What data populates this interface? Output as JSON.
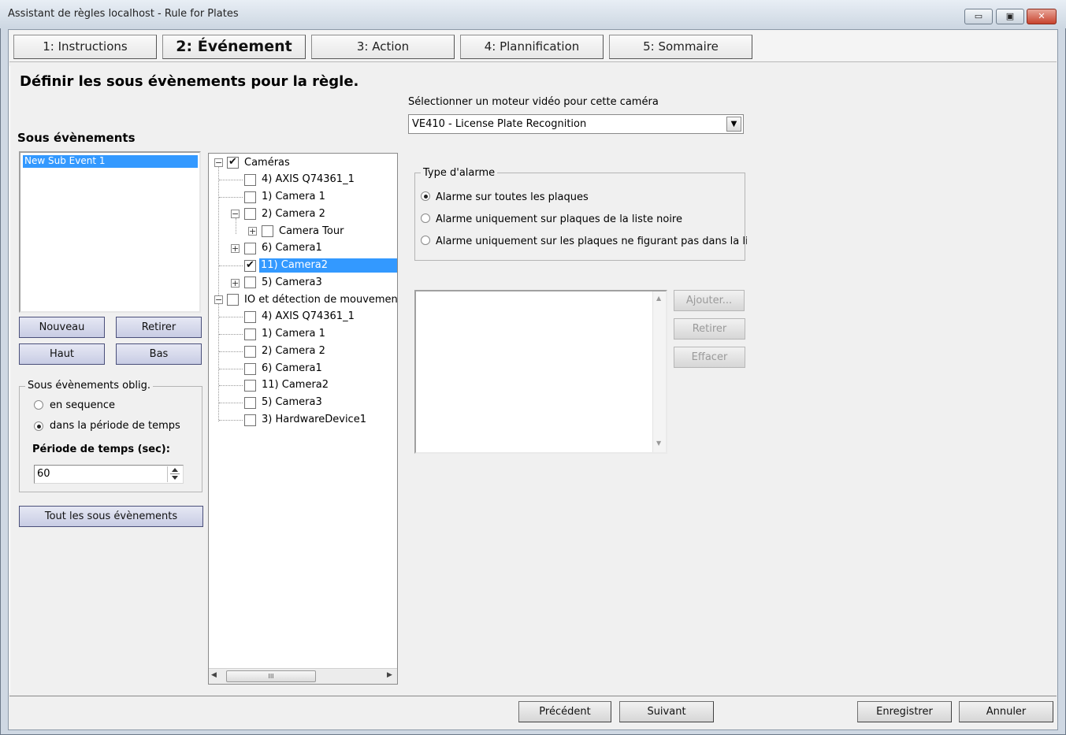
{
  "window": {
    "title": "Assistant de règles localhost - Rule for Plates",
    "minimize": "▭",
    "restore": "▣",
    "close": "✕"
  },
  "tabs": [
    "1: Instructions",
    "2: Événement",
    "3: Action",
    "4: Plannification",
    "5: Sommaire"
  ],
  "active_tab": 1,
  "heading": "Définir les sous évènements pour la règle.",
  "sub_events": {
    "title": "Sous évènements",
    "items": [
      "New Sub Event 1"
    ],
    "selected": 0,
    "buttons": {
      "new": "Nouveau",
      "remove": "Retirer",
      "up": "Haut",
      "down": "Bas",
      "all": "Tout les sous évènements"
    }
  },
  "mandatory": {
    "title": "Sous évènements oblig.",
    "options": [
      "en sequence",
      "dans la période de temps"
    ],
    "selected": 1,
    "period_label": "Période de temps (sec):",
    "period_value": "60"
  },
  "tree": {
    "nodes": [
      {
        "label": "Caméras",
        "checked": true,
        "expander": "−"
      },
      {
        "label": "4) AXIS Q74361_1",
        "checked": false
      },
      {
        "label": "1) Camera 1",
        "checked": false
      },
      {
        "label": "2) Camera 2",
        "checked": false,
        "expander": "−"
      },
      {
        "label": "Camera Tour",
        "checked": false,
        "expander": "+"
      },
      {
        "label": "6) Camera1",
        "checked": false,
        "expander": "+"
      },
      {
        "label": "11) Camera2",
        "checked": true,
        "selected": true
      },
      {
        "label": "5) Camera3",
        "checked": false,
        "expander": "+"
      },
      {
        "label": "IO et détection de mouvement su",
        "checked": false,
        "expander": "−"
      },
      {
        "label": "4) AXIS Q74361_1",
        "checked": false
      },
      {
        "label": "1) Camera 1",
        "checked": false
      },
      {
        "label": "2) Camera 2",
        "checked": false
      },
      {
        "label": "6) Camera1",
        "checked": false
      },
      {
        "label": "11) Camera2",
        "checked": false
      },
      {
        "label": "5) Camera3",
        "checked": false
      },
      {
        "label": "3) HardwareDevice1",
        "checked": false
      }
    ],
    "scroll_grip": "III",
    "scroll_left": "◀",
    "scroll_right": "▶"
  },
  "video_engine": {
    "label": "Sélectionner un moteur vidéo pour cette caméra",
    "value": "VE410 - License Plate Recognition",
    "arrow": "▼"
  },
  "alarm_type": {
    "title": "Type d'alarme",
    "options": [
      "Alarme sur toutes les plaques",
      "Alarme uniquement sur plaques de la liste noire",
      "Alarme uniquement sur les plaques ne figurant pas dans la liste (lis"
    ],
    "selected": 0
  },
  "plate_list": {
    "scroll_up": "▲",
    "scroll_down": "▼",
    "buttons": {
      "add": "Ajouter...",
      "remove": "Retirer",
      "clear": "Effacer"
    }
  },
  "footer": {
    "previous": "Précédent",
    "next": "Suivant",
    "save": "Enregistrer",
    "cancel": "Annuler"
  }
}
